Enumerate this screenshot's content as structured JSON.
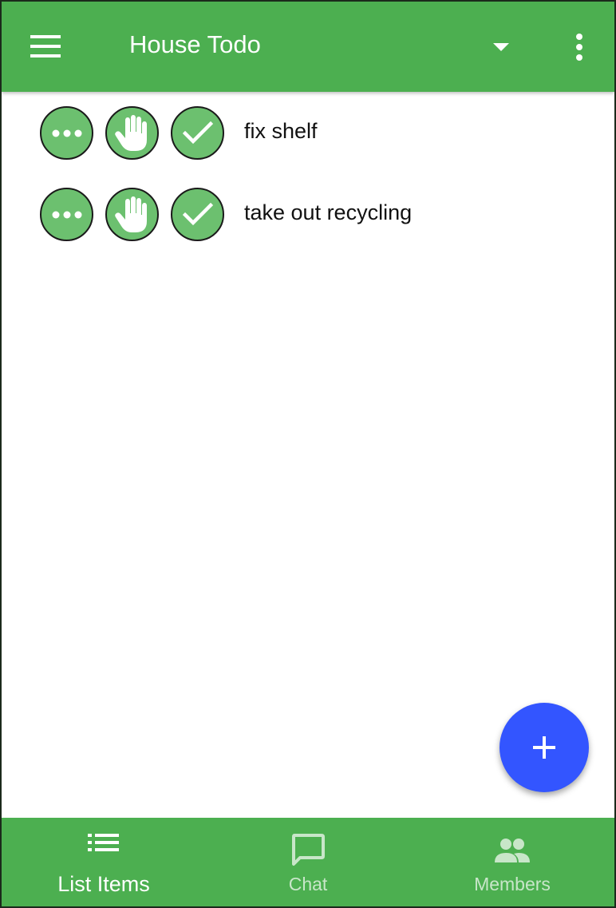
{
  "appbar": {
    "title": "House Todo",
    "menu_icon": "hamburger-icon",
    "dropdown_icon": "caret-down-icon",
    "overflow_icon": "more-vert-icon"
  },
  "items": [
    {
      "text": "fix shelf",
      "actions": [
        "more-horiz-icon",
        "hand-icon",
        "check-icon"
      ]
    },
    {
      "text": "take out recycling",
      "actions": [
        "more-horiz-icon",
        "hand-icon",
        "check-icon"
      ]
    }
  ],
  "fab": {
    "icon": "plus-icon"
  },
  "bottom_nav": {
    "tabs": [
      {
        "label": "List Items",
        "icon": "list-icon",
        "active": true
      },
      {
        "label": "Chat",
        "icon": "chat-bubble-icon",
        "active": false
      },
      {
        "label": "Members",
        "icon": "people-icon",
        "active": false
      }
    ]
  },
  "colors": {
    "primary": "#4caf50",
    "item_button": "#6cc06f",
    "fab": "#3355ff",
    "inactive_tab": "#c8e6c9"
  }
}
